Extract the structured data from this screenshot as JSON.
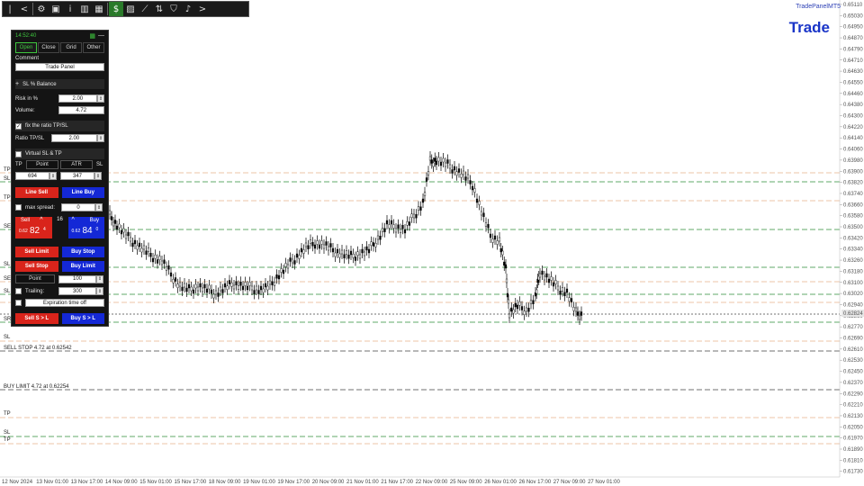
{
  "toolbar": {
    "buttons": [
      {
        "name": "collapse-icon",
        "glyph": "|"
      },
      {
        "name": "arrow-left-icon",
        "glyph": "<"
      },
      {
        "name": "gear-icon",
        "glyph": "⚙"
      },
      {
        "name": "camera-icon",
        "glyph": "▣"
      },
      {
        "name": "info-icon",
        "glyph": "i"
      },
      {
        "name": "bar-chart-icon",
        "glyph": "▥"
      },
      {
        "name": "grid-icon",
        "glyph": "▦"
      },
      {
        "name": "money-icon",
        "glyph": "$"
      },
      {
        "name": "ruler-icon",
        "glyph": "▨"
      },
      {
        "name": "trend-tool-icon",
        "glyph": "⟋"
      },
      {
        "name": "chart-settings-icon",
        "glyph": "⇅"
      },
      {
        "name": "shield-icon",
        "glyph": "⛉"
      },
      {
        "name": "bell-icon",
        "glyph": "♪"
      },
      {
        "name": "chevron-right-icon",
        "glyph": ">"
      }
    ]
  },
  "brand": {
    "subtitle": "TradePanelMT5",
    "title": "Trade"
  },
  "panel": {
    "time": "14:52:40",
    "tabs": [
      "Open",
      "Close",
      "Grid",
      "Other"
    ],
    "comment_label": "Comment",
    "comment_value": "Trade Panel",
    "sl_balance_label": "SL % Balance",
    "risk_label": "Risk in %",
    "risk_value": "2.00",
    "volume_label": "Volume:",
    "volume_value": "4.72",
    "fix_ratio_label": "fix the ratio TP/SL",
    "ratio_label": "Ratio TP/SL",
    "ratio_value": "2.00",
    "virtual_label": "Virtual SL & TP",
    "tp_label": "TP",
    "point_label": "Point",
    "atr_label": "ATR",
    "sl_label": "SL",
    "tp_value": "694",
    "sl_value": "347",
    "line_sell": "Line Sell",
    "line_buy": "Line Buy",
    "max_spread_label": "max spread:",
    "max_spread_value": "0",
    "sell_label": "Sell",
    "buy_label": "Buy",
    "spread": "16",
    "sell_price_small": "0.62",
    "sell_price_big": "82",
    "sell_price_tail": "4",
    "buy_price_small": "0.62",
    "buy_price_big": "84",
    "buy_price_tail": "0",
    "sell_limit": "Sell Limit",
    "buy_stop": "Buy Stop",
    "sell_stop": "Sell Stop",
    "buy_limit": "Buy Limit",
    "point_field_label": "Point",
    "point_field_value": "100",
    "trailing_label": "Trailing:",
    "trailing_value": "300",
    "expiration_label": "Expiration time off",
    "sell_sl": "Sell S > L",
    "buy_sl": "Buy S > L"
  },
  "chart_data": {
    "type": "candlestick",
    "y_ticks": [
      "0.65110",
      "0.65030",
      "0.64950",
      "0.64870",
      "0.64790",
      "0.64710",
      "0.64630",
      "0.64550",
      "0.64460",
      "0.64380",
      "0.64300",
      "0.64220",
      "0.64140",
      "0.64060",
      "0.63980",
      "0.63900",
      "0.63820",
      "0.63740",
      "0.63660",
      "0.63580",
      "0.63500",
      "0.63420",
      "0.63340",
      "0.63260",
      "0.63180",
      "0.63100",
      "0.63020",
      "0.62940",
      "0.62860",
      "0.62770",
      "0.62690",
      "0.62610",
      "0.62530",
      "0.62450",
      "0.62370",
      "0.62290",
      "0.62210",
      "0.62130",
      "0.62050",
      "0.61970",
      "0.61890",
      "0.61810",
      "0.61730"
    ],
    "x_ticks": [
      "12 Nov 2024",
      "13 Nov 01:00",
      "13 Nov 17:00",
      "14 Nov 09:00",
      "15 Nov 01:00",
      "15 Nov 17:00",
      "18 Nov 09:00",
      "19 Nov 01:00",
      "19 Nov 17:00",
      "20 Nov 09:00",
      "21 Nov 01:00",
      "21 Nov 17:00",
      "22 Nov 09:00",
      "25 Nov 09:00",
      "26 Nov 01:00",
      "26 Nov 17:00",
      "27 Nov 09:00",
      "27 Nov 01:00"
    ],
    "current_price": "0.62824",
    "line_labels": [
      {
        "text": "TP"
      },
      {
        "text": "SL"
      },
      {
        "text": "TP"
      },
      {
        "text": "SE"
      },
      {
        "text": "SL"
      },
      {
        "text": "SE"
      },
      {
        "text": "SL"
      },
      {
        "text": "SR"
      },
      {
        "text": "SL"
      },
      {
        "text": "SELL STOP 4.72 at 0.62542"
      },
      {
        "text": "BUY LIMIT 4.72 at 0.62254"
      },
      {
        "text": "TP"
      },
      {
        "text": "SL"
      },
      {
        "text": "TP"
      }
    ],
    "colors": {
      "tp": "#e8b48a",
      "sl": "#2f8f3a",
      "entry": "#444444",
      "candle": "#000000",
      "price": "#888888"
    }
  }
}
